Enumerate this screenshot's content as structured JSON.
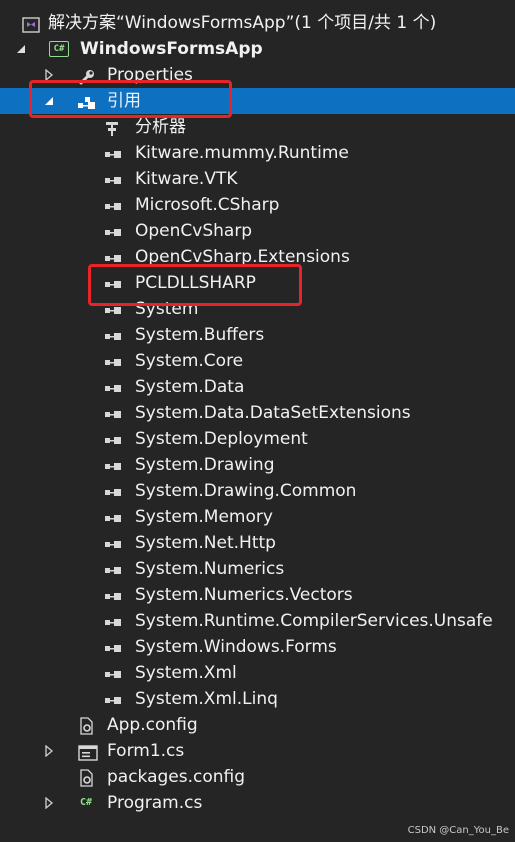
{
  "solution": {
    "label": "解决方案“WindowsFormsApp”(1 个项目/共 1 个)"
  },
  "project": {
    "label": "WindowsFormsApp",
    "badge": "C#"
  },
  "nodes": {
    "properties": "Properties",
    "references": "引用",
    "analyzers": "分析器",
    "app_config": "App.config",
    "form1": "Form1.cs",
    "packages_config": "packages.config",
    "program": "Program.cs",
    "program_badge": "C#"
  },
  "references": [
    "Kitware.mummy.Runtime",
    "Kitware.VTK",
    "Microsoft.CSharp",
    "OpenCvSharp",
    "OpenCvSharp.Extensions",
    "PCLDLLSHARP",
    "System",
    "System.Buffers",
    "System.Core",
    "System.Data",
    "System.Data.DataSetExtensions",
    "System.Deployment",
    "System.Drawing",
    "System.Drawing.Common",
    "System.Memory",
    "System.Net.Http",
    "System.Numerics",
    "System.Numerics.Vectors",
    "System.Runtime.CompilerServices.Unsafe",
    "System.Windows.Forms",
    "System.Xml",
    "System.Xml.Linq"
  ],
  "watermark": "CSDN @Can_You_Be",
  "colors": {
    "background": "#252526",
    "selection": "#0e70c0",
    "highlight": "#e8232a",
    "csharp": "#8ee08e"
  }
}
